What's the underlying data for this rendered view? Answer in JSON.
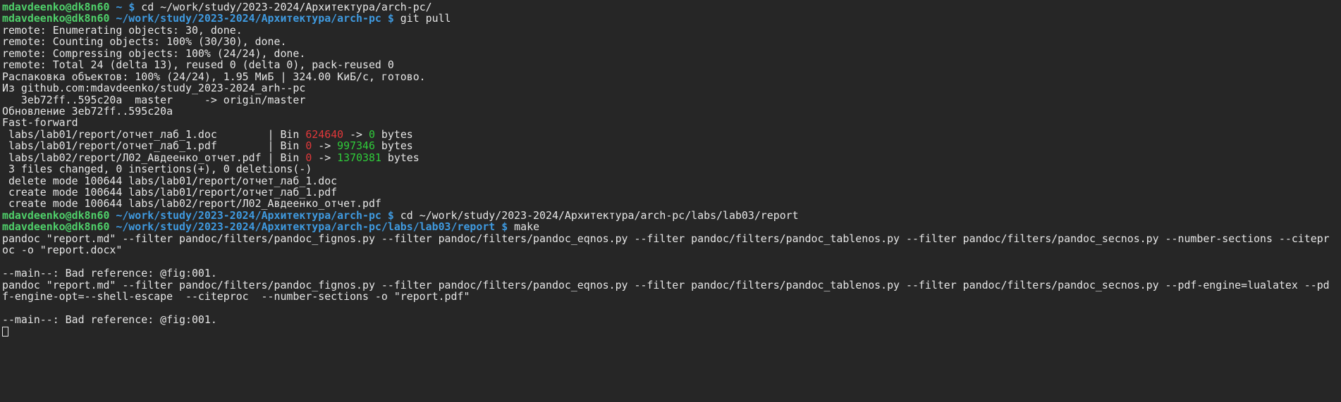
{
  "colors": {
    "background": "#262626",
    "text": "#e6e6e6",
    "prompt_user": "#4fd06a",
    "prompt_path": "#3f9ae0",
    "deletions": "#e0383a",
    "insertions": "#2fcc3a"
  },
  "lines": [
    [
      [
        "mdavdeenko@dk8n60 ",
        "u"
      ],
      [
        "~ ",
        "p"
      ],
      [
        "$ ",
        "p"
      ],
      [
        "cd ~/work/study/2023-2024/Архитектура/arch-pc/",
        ""
      ]
    ],
    [
      [
        "mdavdeenko@dk8n60 ",
        "u"
      ],
      [
        "~/work/study/2023-2024/Архитектура/arch-pc $ ",
        "p"
      ],
      [
        "git pull",
        ""
      ]
    ],
    [
      [
        "remote: Enumerating objects: 30, done.",
        ""
      ]
    ],
    [
      [
        "remote: Counting objects: 100% (30/30), done.",
        ""
      ]
    ],
    [
      [
        "remote: Compressing objects: 100% (24/24), done.",
        ""
      ]
    ],
    [
      [
        "remote: Total 24 (delta 13), reused 0 (delta 0), pack-reused 0",
        ""
      ]
    ],
    [
      [
        "Распаковка объектов: 100% (24/24), 1.95 МиБ | 324.00 КиБ/с, готово.",
        ""
      ]
    ],
    [
      [
        "Из github.com:mdavdeenko/study_2023-2024_arh--pc",
        ""
      ]
    ],
    [
      [
        "   3eb72ff..595c20a  master     -> origin/master",
        ""
      ]
    ],
    [
      [
        "Обновление 3eb72ff..595c20a",
        ""
      ]
    ],
    [
      [
        "Fast-forward",
        ""
      ]
    ],
    [
      [
        " labs/lab01/report/отчет_лаб_1.doc        | Bin ",
        ""
      ],
      [
        "624640",
        "r"
      ],
      [
        " -> ",
        ""
      ],
      [
        "0",
        "g"
      ],
      [
        " bytes",
        ""
      ]
    ],
    [
      [
        " labs/lab01/report/отчет_лаб_1.pdf        | Bin ",
        ""
      ],
      [
        "0",
        "r"
      ],
      [
        " -> ",
        ""
      ],
      [
        "997346",
        "g"
      ],
      [
        " bytes",
        ""
      ]
    ],
    [
      [
        " labs/lab02/report/Л02_Авдеенко_отчет.pdf | Bin ",
        ""
      ],
      [
        "0",
        "r"
      ],
      [
        " -> ",
        ""
      ],
      [
        "1370381",
        "g"
      ],
      [
        " bytes",
        ""
      ]
    ],
    [
      [
        " 3 files changed, 0 insertions(+), 0 deletions(-)",
        ""
      ]
    ],
    [
      [
        " delete mode 100644 labs/lab01/report/отчет_лаб_1.doc",
        ""
      ]
    ],
    [
      [
        " create mode 100644 labs/lab01/report/отчет_лаб_1.pdf",
        ""
      ]
    ],
    [
      [
        " create mode 100644 labs/lab02/report/Л02_Авдеенко_отчет.pdf",
        ""
      ]
    ],
    [
      [
        "mdavdeenko@dk8n60 ",
        "u"
      ],
      [
        "~/work/study/2023-2024/Архитектура/arch-pc $ ",
        "p"
      ],
      [
        "cd ~/work/study/2023-2024/Архитектура/arch-pc/labs/lab03/report",
        ""
      ]
    ],
    [
      [
        "mdavdeenko@dk8n60 ",
        "u"
      ],
      [
        "~/work/study/2023-2024/Архитектура/arch-pc/labs/lab03/report $ ",
        "p"
      ],
      [
        "make",
        ""
      ]
    ],
    [
      [
        "pandoc \"report.md\" --filter pandoc/filters/pandoc_fignos.py --filter pandoc/filters/pandoc_eqnos.py --filter pandoc/filters/pandoc_tablenos.py --filter pandoc/filters/pandoc_secnos.py --number-sections --citepr",
        ""
      ]
    ],
    [
      [
        "oc -o \"report.docx\"",
        ""
      ]
    ],
    [
      [
        "",
        ""
      ]
    ],
    [
      [
        "--main--: Bad reference: @fig:001.",
        ""
      ]
    ],
    [
      [
        "pandoc \"report.md\" --filter pandoc/filters/pandoc_fignos.py --filter pandoc/filters/pandoc_eqnos.py --filter pandoc/filters/pandoc_tablenos.py --filter pandoc/filters/pandoc_secnos.py --pdf-engine=lualatex --pd",
        ""
      ]
    ],
    [
      [
        "f-engine-opt=--shell-escape  --citeproc  --number-sections -o \"report.pdf\"",
        ""
      ]
    ],
    [
      [
        "",
        ""
      ]
    ],
    [
      [
        "--main--: Bad reference: @fig:001.",
        ""
      ]
    ]
  ]
}
